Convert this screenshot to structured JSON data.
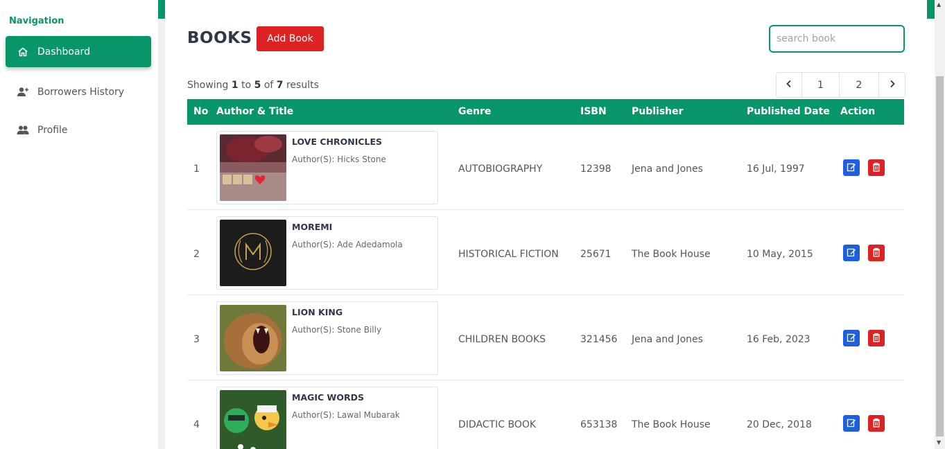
{
  "sidebar": {
    "heading": "Navigation",
    "items": [
      {
        "label": "Dashboard",
        "icon": "home-icon",
        "active": true
      },
      {
        "label": "Borrowers History",
        "icon": "user-plus-icon",
        "active": false
      },
      {
        "label": "Profile",
        "icon": "users-icon",
        "active": false
      }
    ]
  },
  "header": {
    "title": "BOOKS",
    "add_label": "Add Book",
    "search_placeholder": "search book"
  },
  "summary": {
    "prefix": "Showing",
    "from": "1",
    "to_word": "to",
    "to": "5",
    "of_word": "of",
    "total": "7",
    "suffix": "results"
  },
  "pagination": {
    "prev": "‹",
    "pages": [
      "1",
      "2"
    ],
    "next": "›"
  },
  "table": {
    "columns": [
      "No",
      "Author & Title",
      "Genre",
      "ISBN",
      "Publisher",
      "Published Date",
      "Action"
    ],
    "rows": [
      {
        "no": "1",
        "title": "LOVE CHRONICLES",
        "author": "Author(S): Hicks Stone",
        "genre": "AUTOBIOGRAPHY",
        "isbn": "12398",
        "publisher": "Jena and Jones",
        "date": "16 Jul, 1997"
      },
      {
        "no": "2",
        "title": "MOREMI",
        "author": "Author(S): Ade Adedamola",
        "genre": "HISTORICAL FICTION",
        "isbn": "25671",
        "publisher": "The Book House",
        "date": "10 May, 2015"
      },
      {
        "no": "3",
        "title": "LION KING",
        "author": "Author(S): Stone Billy",
        "genre": "CHILDREN BOOKS",
        "isbn": "321456",
        "publisher": "Jena and Jones",
        "date": "16 Feb, 2023"
      },
      {
        "no": "4",
        "title": "MAGIC WORDS",
        "author": "Author(S): Lawal Mubarak",
        "genre": "DIDACTIC BOOK",
        "isbn": "653138",
        "publisher": "The Book House",
        "date": "20 Dec, 2018"
      }
    ]
  },
  "colors": {
    "brand_green": "#079669",
    "danger_red": "#dc2222",
    "edit_blue": "#1d5fe0"
  }
}
